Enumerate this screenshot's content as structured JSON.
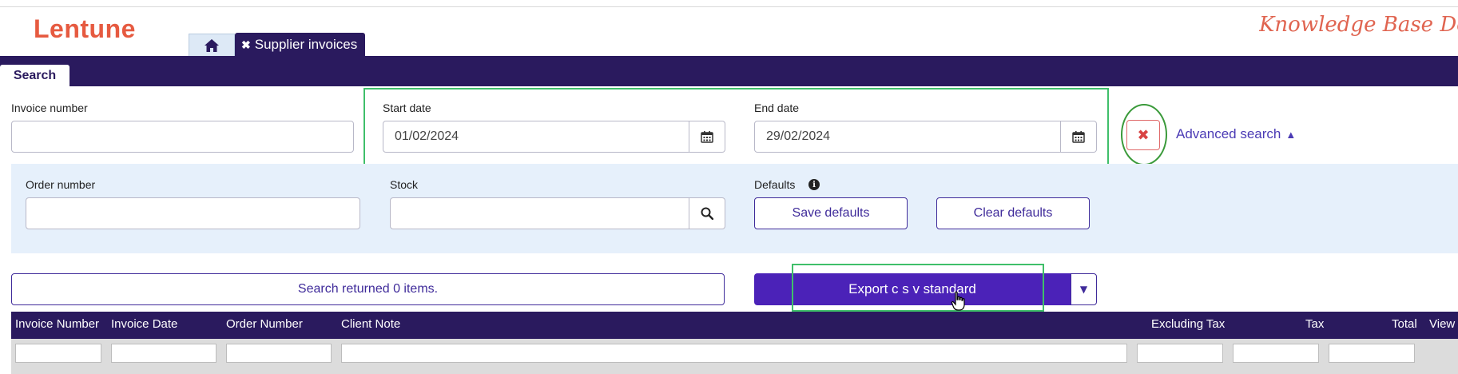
{
  "app": {
    "logo": "Lentune",
    "brand_right": "Knowledge Base Demo"
  },
  "tabs": [
    {
      "icon": "home-icon"
    },
    {
      "label": "Supplier invoices",
      "close": "✖"
    }
  ],
  "search_tab": "Search",
  "form": {
    "invoice_number": {
      "label": "Invoice number",
      "value": ""
    },
    "start_date": {
      "label": "Start date",
      "value": "01/02/2024"
    },
    "end_date": {
      "label": "End date",
      "value": "29/02/2024"
    },
    "clear_button": "✖",
    "advanced_search": "Advanced search",
    "order_number": {
      "label": "Order number",
      "value": ""
    },
    "stock": {
      "label": "Stock",
      "value": ""
    },
    "defaults": {
      "label": "Defaults",
      "save": "Save defaults",
      "clear": "Clear defaults"
    }
  },
  "results": {
    "status": "Search returned 0 items.",
    "export_label": "Export c s v standard"
  },
  "table": {
    "columns": [
      "Invoice Number",
      "Invoice Date",
      "Order Number",
      "Client Note",
      "Excluding Tax",
      "Tax",
      "Total",
      "View"
    ]
  },
  "colors": {
    "brand": "#e65a40",
    "nav": "#2a1a5e",
    "primary": "#4b22b8",
    "highlight": "#3fbf6a"
  }
}
